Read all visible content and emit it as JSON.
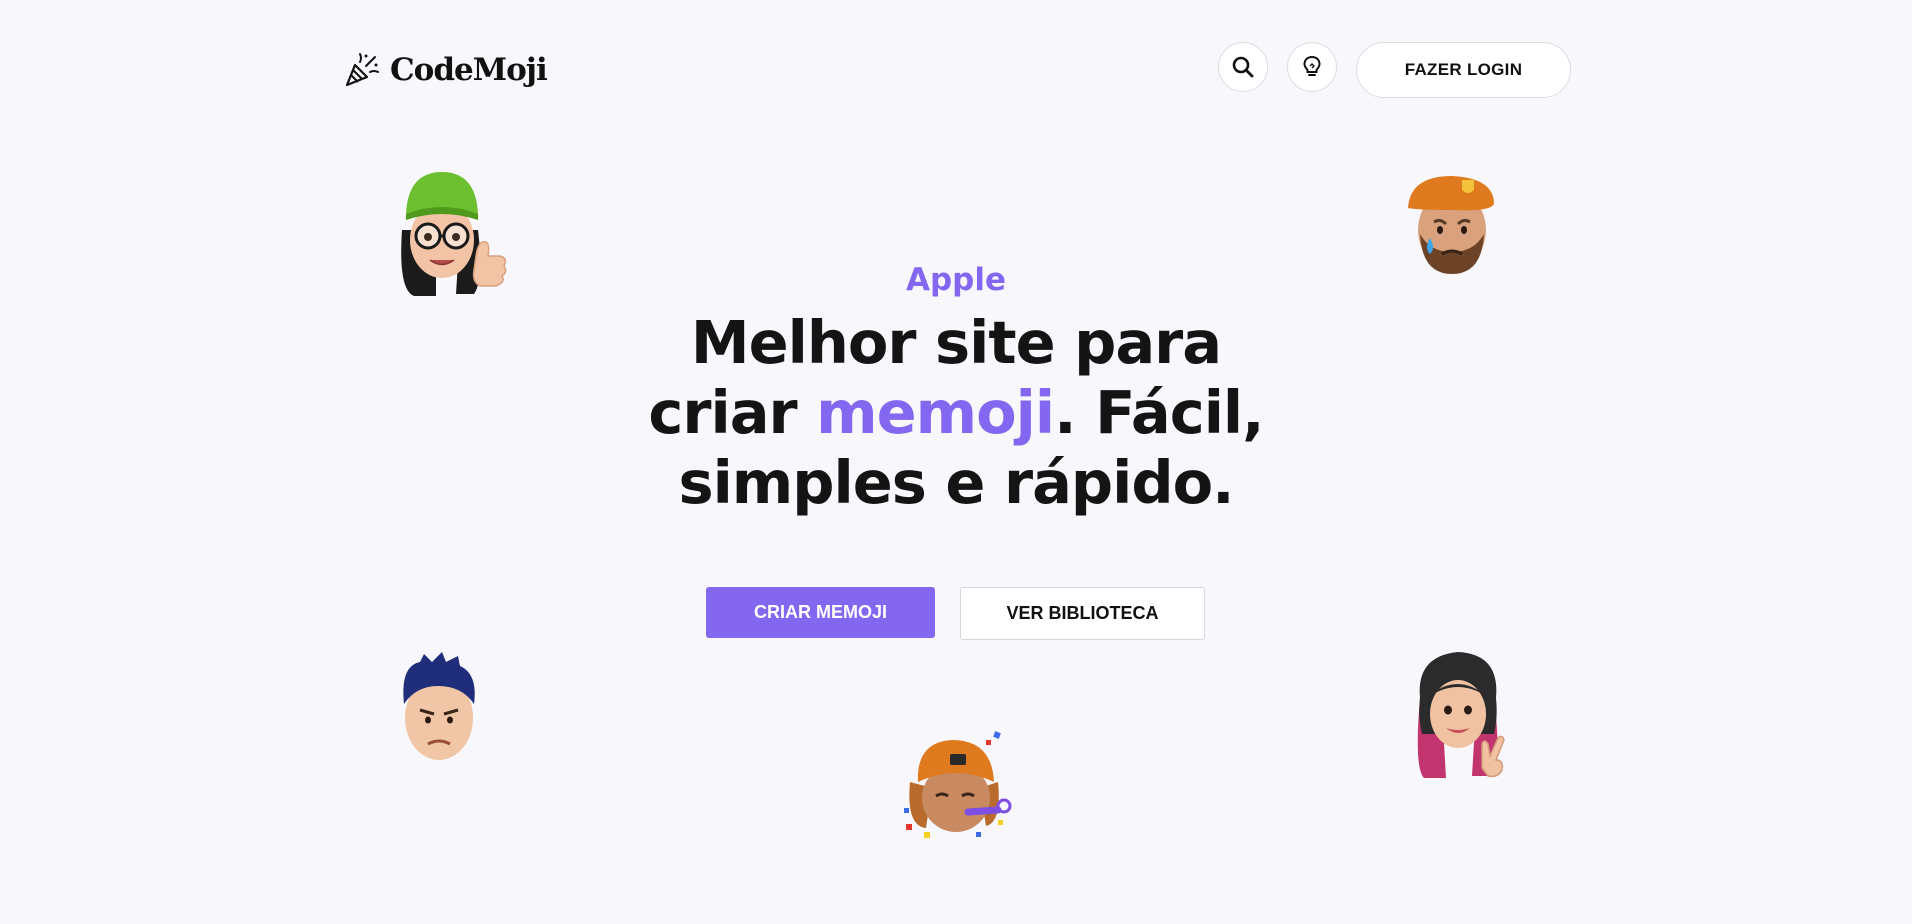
{
  "header": {
    "logo_text": "CodeMoji",
    "search_icon": "search-icon",
    "ideas_icon": "lightbulb-icon",
    "login_label": "FAZER LOGIN"
  },
  "hero": {
    "eyebrow": "Apple",
    "headline_part1": "Melhor site para",
    "headline_part2_prefix": "criar ",
    "headline_accent": "memoji",
    "headline_part2_suffix": ". Fácil,",
    "headline_part3": "simples e rápido.",
    "primary_cta": "CRIAR MEMOJI",
    "secondary_cta": "VER BIBLIOTECA"
  },
  "colors": {
    "accent": "#8367f0",
    "text": "#141414",
    "background": "#f8f8fc"
  },
  "memojis": [
    {
      "name": "memoji-green-beanie-thumbs-up"
    },
    {
      "name": "memoji-orange-beret-crying"
    },
    {
      "name": "memoji-blue-hair-serious"
    },
    {
      "name": "memoji-orange-cap-party"
    },
    {
      "name": "memoji-dark-hair-peace-sign"
    }
  ]
}
